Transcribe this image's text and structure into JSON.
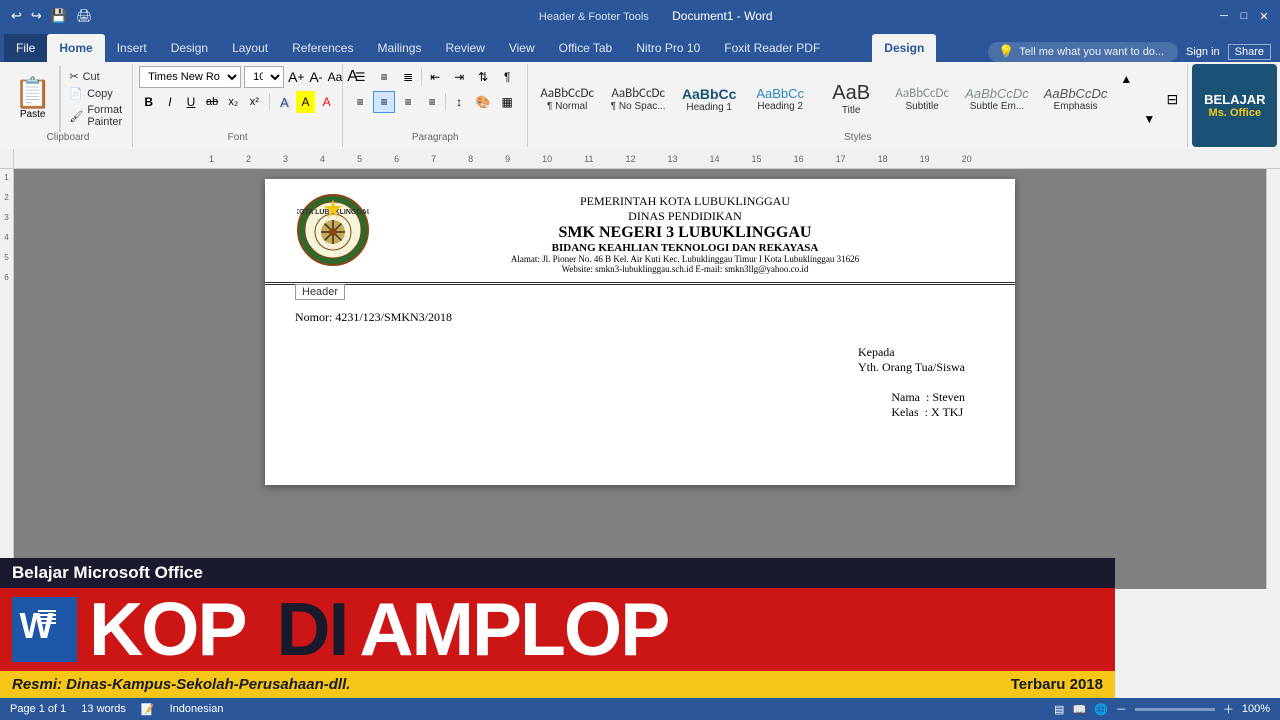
{
  "titlebar": {
    "title": "Document1 - Word",
    "hf_tools": "Header & Footer Tools",
    "min_btn": "─",
    "max_btn": "□",
    "close_btn": "✕",
    "quick_access": [
      "↩",
      "↪",
      "💾",
      "🖨",
      "↩"
    ]
  },
  "ribbon": {
    "tabs": [
      "File",
      "Home",
      "Insert",
      "Design",
      "Layout",
      "References",
      "Mailings",
      "Review",
      "View",
      "Office Tab",
      "Nitro Pro 10",
      "Foxit Reader PDF",
      "Design"
    ],
    "active_tab": "Home",
    "design_tab": "Design",
    "clipboard": {
      "paste_label": "Paste",
      "cut_label": "Cut",
      "copy_label": "Copy",
      "format_painter_label": "Format Painter",
      "group_label": "Clipboard"
    },
    "font": {
      "name": "Times New Ro",
      "size": "10",
      "bold": "B",
      "italic": "I",
      "underline": "U",
      "strikethrough": "ab",
      "subscript": "x₂",
      "superscript": "x²",
      "group_label": "Font"
    },
    "paragraph": {
      "group_label": "Paragraph"
    },
    "styles": {
      "group_label": "Styles",
      "items": [
        {
          "sample": "AaBbCcDc",
          "label": "¶ Normal",
          "style": "normal"
        },
        {
          "sample": "AaBbCcDc",
          "label": "¶ No Spac...",
          "style": "no-space"
        },
        {
          "sample": "AaBbCc",
          "label": "Heading 1",
          "style": "h1"
        },
        {
          "sample": "AaBbCc",
          "label": "Heading 2",
          "style": "h2"
        },
        {
          "sample": "AaB",
          "label": "Title",
          "style": "title"
        },
        {
          "sample": "AaBbCcDc",
          "label": "Subtitle",
          "style": "subtitle"
        },
        {
          "sample": "AaBbCcDc",
          "label": "Subtle Em...",
          "style": "subtle-em"
        },
        {
          "sample": "AaBbCcDc",
          "label": "Emphasis",
          "style": "emphasis"
        }
      ]
    },
    "tell_me": "Tell me what you want to do...",
    "sign_in": "Sign in",
    "share": "Share"
  },
  "document": {
    "header": {
      "line1": "PEMERINTAH KOTA LUBUKLINGGAU",
      "line2": "DINAS PENDIDIKAN",
      "line3": "SMK NEGERI 3 LUBUKLINGGAU",
      "line4": "BIDANG KEAHLIAN TEKNOLOGI DAN REKAYASA",
      "line5": "Alamat: Jl. Pioner No. 46 B Kel. Air Kuti Kec. Lubuklinggau Timur I Kota Lubuklinggau 31626",
      "line6": "Website: smkn3-lubuklinggau.sch.id   E-mail: smkn3llg@yahoo.co.id",
      "header_label": "Header"
    },
    "body": {
      "nomor": "Nomor: 4231/123/SMKN3/2018",
      "kepada_label": "Kepada",
      "kepada_value": "Yth. Orang Tua/Siswa",
      "nama_label": "Nama",
      "nama_value": ": Steven",
      "kelas_label": "Kelas",
      "kelas_value": ": X TKJ"
    }
  },
  "banner": {
    "title": "Belajar Microsoft Office",
    "kop": "KOP",
    "di": "DI",
    "amplop": "AMPLOP",
    "bottom_left": "Resmi: Dinas-Kampus-Sekolah-Perusahaan-dll.",
    "bottom_right": "Terbaru 2018"
  },
  "belajar_logo": {
    "line1": "BELAJAR",
    "line2": "Ms. Office"
  },
  "statusbar": {
    "page": "Page 1 of 1",
    "words": "13 words",
    "language": "Indonesian",
    "zoom": "100%"
  }
}
